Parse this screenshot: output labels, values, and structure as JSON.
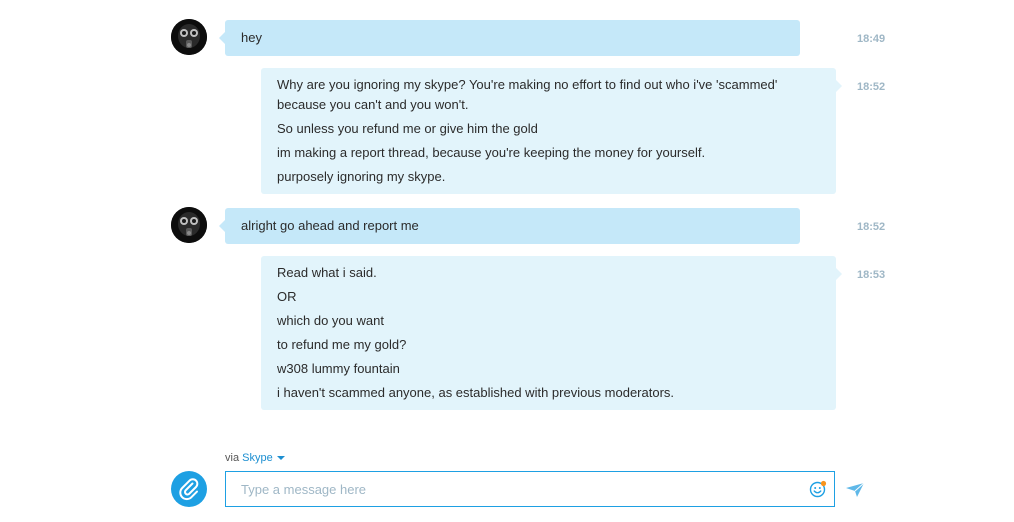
{
  "conversation": {
    "messages": [
      {
        "direction": "incoming",
        "avatar": "gas-mask-avatar",
        "lines": [
          "hey"
        ],
        "time": "18:49"
      },
      {
        "direction": "outgoing",
        "lines": [
          "Why are you ignoring my skype? You're making no effort to find out who i've 'scammed' because you can't and you won't.",
          "So unless you refund me or give him the gold",
          "im making a report thread, because you're keeping the money for yourself.",
          "purposely ignoring my skype."
        ],
        "time": "18:52"
      },
      {
        "direction": "incoming",
        "avatar": "gas-mask-avatar",
        "lines": [
          "alright go ahead and report me"
        ],
        "time": "18:52"
      },
      {
        "direction": "outgoing",
        "lines": [
          "Read what i said.",
          "OR",
          "which do you want",
          "to refund me my gold?",
          "w308 lummy fountain",
          "i haven't scammed anyone, as established with previous moderators."
        ],
        "time": "18:53"
      }
    ]
  },
  "composer": {
    "via_prefix": "via",
    "via_service": "Skype",
    "placeholder": "Type a message here",
    "value": "",
    "attach_icon": "paperclip-icon",
    "emoji_icon": "smiley-icon",
    "send_icon": "send-arrow-icon"
  },
  "colors": {
    "incoming_bubble": "#c5e8f9",
    "outgoing_bubble": "#e2f4fb",
    "accent": "#1ea0e3",
    "timestamp": "#9fb7c6",
    "notification_dot": "#f7941d"
  }
}
